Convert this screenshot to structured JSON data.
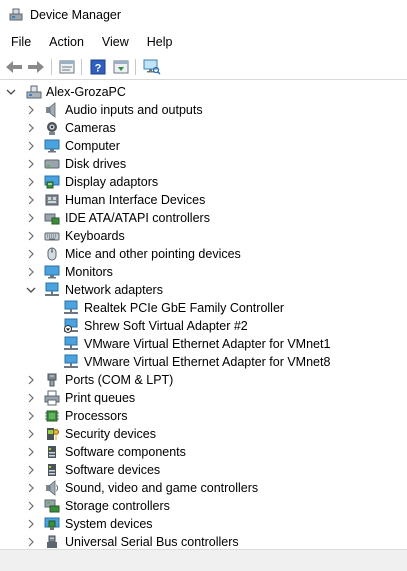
{
  "window": {
    "title": "Device Manager"
  },
  "menu": [
    "File",
    "Action",
    "View",
    "Help"
  ],
  "toolbar": {
    "buttons": [
      "back-icon",
      "forward-icon",
      "properties-icon",
      "help-icon",
      "update-driver-icon",
      "scan-hardware-icon"
    ]
  },
  "tree": {
    "root": "Alex-GrozaPC",
    "categories": [
      {
        "label": "Audio inputs and outputs",
        "icon": "speaker-icon",
        "expanded": false
      },
      {
        "label": "Cameras",
        "icon": "camera-icon",
        "expanded": false
      },
      {
        "label": "Computer",
        "icon": "computer-icon",
        "expanded": false
      },
      {
        "label": "Disk drives",
        "icon": "disk-drive-icon",
        "expanded": false
      },
      {
        "label": "Display adaptors",
        "icon": "display-adapter-icon",
        "expanded": false
      },
      {
        "label": "Human Interface Devices",
        "icon": "hid-icon",
        "expanded": false
      },
      {
        "label": "IDE ATA/ATAPI controllers",
        "icon": "ide-controller-icon",
        "expanded": false
      },
      {
        "label": "Keyboards",
        "icon": "keyboard-icon",
        "expanded": false
      },
      {
        "label": "Mice and other pointing devices",
        "icon": "mouse-icon",
        "expanded": false
      },
      {
        "label": "Monitors",
        "icon": "monitor-icon",
        "expanded": false
      },
      {
        "label": "Network adapters",
        "icon": "network-adapter-icon",
        "expanded": true,
        "children": [
          "Realtek PCIe GbE Family Controller",
          "Shrew Soft Virtual Adapter #2",
          "VMware Virtual Ethernet Adapter for VMnet1",
          "VMware Virtual Ethernet Adapter for VMnet8"
        ]
      },
      {
        "label": "Ports (COM & LPT)",
        "icon": "port-icon",
        "expanded": false
      },
      {
        "label": "Print queues",
        "icon": "printer-icon",
        "expanded": false
      },
      {
        "label": "Processors",
        "icon": "processor-icon",
        "expanded": false
      },
      {
        "label": "Security devices",
        "icon": "security-device-icon",
        "expanded": false
      },
      {
        "label": "Software components",
        "icon": "software-component-icon",
        "expanded": false
      },
      {
        "label": "Software devices",
        "icon": "software-device-icon",
        "expanded": false
      },
      {
        "label": "Sound, video and game controllers",
        "icon": "sound-icon",
        "expanded": false
      },
      {
        "label": "Storage controllers",
        "icon": "storage-controller-icon",
        "expanded": false
      },
      {
        "label": "System devices",
        "icon": "system-device-icon",
        "expanded": false
      },
      {
        "label": "Universal Serial Bus controllers",
        "icon": "usb-icon",
        "expanded": false
      }
    ]
  },
  "colors": {
    "accent": "#1e73c8",
    "chevron": "#6e6e6e"
  }
}
